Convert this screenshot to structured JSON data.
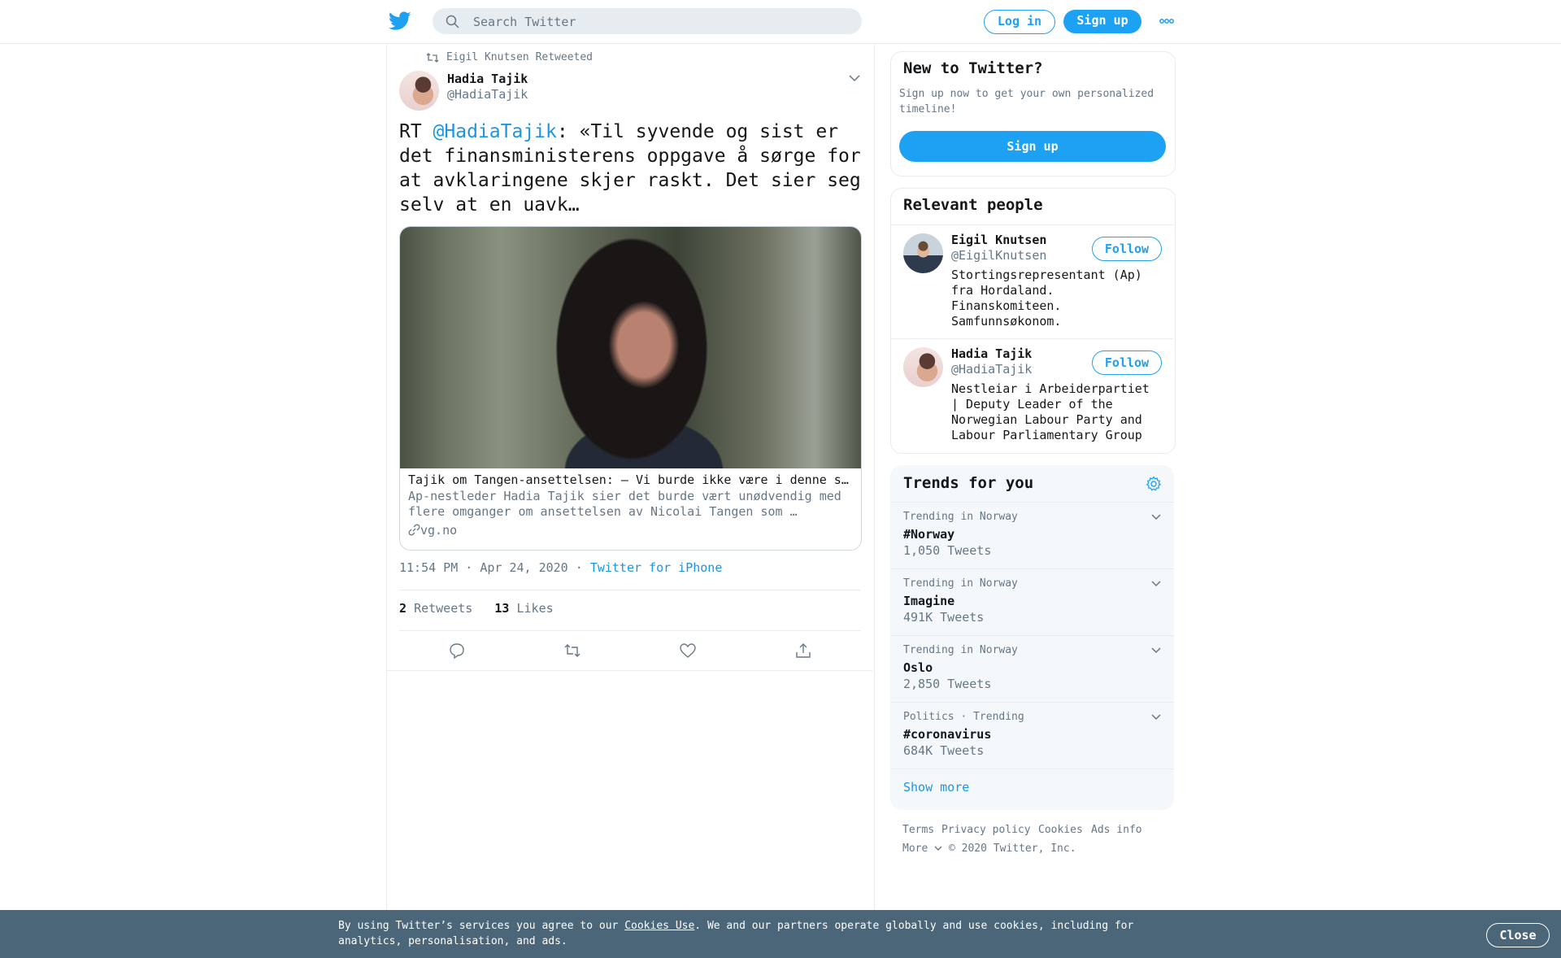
{
  "header": {
    "search_placeholder": "Search Twitter",
    "login_label": "Log in",
    "signup_label": "Sign up"
  },
  "tweet": {
    "retweeted_by": "Eigil Knutsen Retweeted",
    "author_name": "Hadia Tajik",
    "author_handle": "@HadiaTajik",
    "text_prefix": "RT ",
    "text_mention": "@HadiaTajik",
    "text_body": ": «Til syvende og sist er det finansministerens oppgave å sørge for at avklaringene skjer raskt. Det sier seg selv at en uavk…",
    "card": {
      "title": "Tajik om Tangen-ansettelsen: – Vi burde ikke være i denne situasjonen",
      "description": "Ap-nestleder Hadia Tajik sier det burde vært unødvendig med flere omganger om ansettelsen av Nicolai Tangen som …",
      "domain": "vg.no"
    },
    "time": "11:54 PM · Apr 24, 2020",
    "separator": " · ",
    "via": "Twitter for iPhone",
    "retweets_count": "2",
    "retweets_label": "Retweets",
    "likes_count": "13",
    "likes_label": "Likes"
  },
  "new_to_twitter": {
    "title": "New to Twitter?",
    "subtitle": "Sign up now to get your own personalized timeline!",
    "button": "Sign up"
  },
  "relevant_people": {
    "title": "Relevant people",
    "people": [
      {
        "name": "Eigil Knutsen",
        "handle": "@EigilKnutsen",
        "follow": "Follow",
        "bio": "Stortingsrepresentant (Ap) fra Hordaland. Finanskomiteen. Samfunnsøkonom."
      },
      {
        "name": "Hadia Tajik",
        "handle": "@HadiaTajik",
        "follow": "Follow",
        "bio": "Nestleiar i Arbeiderpartiet | Deputy Leader of the Norwegian Labour Party and Labour Parliamentary Group"
      }
    ]
  },
  "trends": {
    "title": "Trends for you",
    "items": [
      {
        "category": "Trending in Norway",
        "name": "#Norway",
        "count": "1,050 Tweets"
      },
      {
        "category": "Trending in Norway",
        "name": "Imagine",
        "count": "491K Tweets"
      },
      {
        "category": "Trending in Norway",
        "name": "Oslo",
        "count": "2,850 Tweets"
      },
      {
        "category": "Politics · Trending",
        "name": "#coronavirus",
        "count": "684K Tweets"
      }
    ],
    "show_more": "Show more"
  },
  "footer": {
    "terms": "Terms",
    "privacy": "Privacy policy",
    "cookies": "Cookies",
    "ads": "Ads info",
    "more": "More",
    "copyright": "© 2020 Twitter, Inc."
  },
  "cookie_banner": {
    "text_before": "By using Twitter’s services you agree to our ",
    "link": "Cookies Use",
    "text_after": ". We and our partners operate globally and use cookies, including for analytics, personalisation, and ads.",
    "close": "Close"
  },
  "colors": {
    "brand_blue": "#1da1f2",
    "link_blue": "#1b95e0",
    "banner_bg": "#4b6579"
  }
}
